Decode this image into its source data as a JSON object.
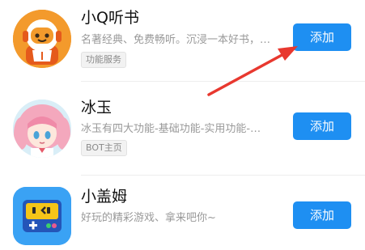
{
  "items": [
    {
      "title": "小Q听书",
      "desc": "名著经典、免费畅听。沉浸一本好书，…",
      "tag": "功能服务",
      "button": "添加",
      "avatar_icon": "headphone-robot-icon"
    },
    {
      "title": "冰玉",
      "desc": "冰玉有四大功能-基础功能-实用功能-…",
      "tag": "BOT主页",
      "button": "添加",
      "avatar_icon": "anime-girl-avatar"
    },
    {
      "title": "小盖姆",
      "desc": "好玩的精彩游戏、拿来吧你~",
      "tag": "",
      "button": "添加",
      "avatar_icon": "gamepad-robot-icon"
    }
  ],
  "colors": {
    "button": "#1e8ff2",
    "arrow": "#e8382f"
  }
}
